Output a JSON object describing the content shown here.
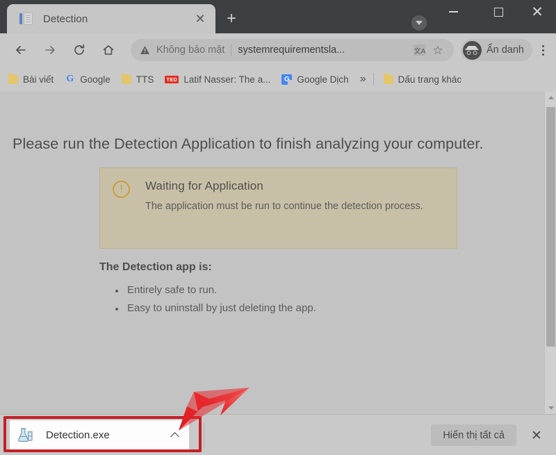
{
  "window": {
    "controls": {
      "dropdown": "window-dropdown",
      "minimize": "–",
      "maximize": "□",
      "close": "✕"
    }
  },
  "tabstrip": {
    "tabs": [
      {
        "title": "Detection",
        "favicon": "document-icon",
        "close_label": "✕"
      }
    ],
    "new_tab_label": "+"
  },
  "toolbar": {
    "back_label": "back-arrow",
    "forward_label": "forward-arrow",
    "reload_label": "reload",
    "home_label": "home",
    "omnibox": {
      "warning_icon": "not-secure-warning",
      "security_text": "Không bảo mật",
      "separator": "|",
      "url": "systemrequirementsla...",
      "translate_icon_label": "文A",
      "bookmark_star": "☆"
    },
    "incognito": {
      "label": "Ẩn danh",
      "icon": "incognito-icon"
    },
    "menu_label": "chrome-menu"
  },
  "bookmarks": {
    "items": [
      {
        "label": "Bài viết",
        "icon": "folder"
      },
      {
        "label": "Google",
        "icon": "google",
        "glyph": "G"
      },
      {
        "label": "TTS",
        "icon": "folder"
      },
      {
        "label": "Latif Nasser: The a...",
        "icon": "ted",
        "glyph": "TED"
      },
      {
        "label": "Google Dịch",
        "icon": "gtranslate",
        "glyph": "G"
      }
    ],
    "overflow_label": "»",
    "other_bookmarks": {
      "label": "Dấu trang khác",
      "icon": "folder"
    }
  },
  "page": {
    "heading": "Please run the Detection Application to finish analyzing your computer.",
    "alert": {
      "icon": "exclamation-circle-icon",
      "icon_glyph": "!",
      "title": "Waiting for Application",
      "text": "The application must be run to continue the detection process.",
      "bg_color": "#c8c0a6",
      "accent_color": "#c89f3c"
    },
    "list_heading": "The Detection app is:",
    "list_items": [
      "Entirely safe to run.",
      "Easy to uninstall by just deleting the app."
    ]
  },
  "scrollbar": {
    "up_label": "scroll-up",
    "down_label": "scroll-down"
  },
  "download_shelf": {
    "item": {
      "filename": "Detection.exe",
      "icon": "flask-icon",
      "menu_label": "chevron-up"
    },
    "show_all_label": "Hiển thị tất cả",
    "close_label": "✕"
  },
  "annotation": {
    "highlight_color": "#c42026",
    "arrow_color": "#e8161f",
    "target": "download-item"
  }
}
